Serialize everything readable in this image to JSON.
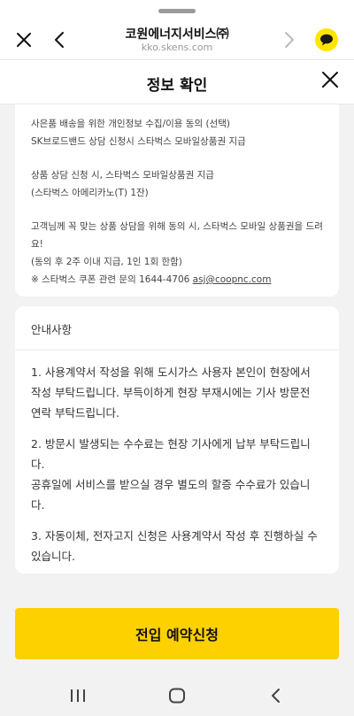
{
  "browser": {
    "title": "코원에너지서비스㈜",
    "url": "kko.skens.com"
  },
  "sheet": {
    "title": "정보 확인"
  },
  "consent": {
    "line1": "사은품 배송을 위한 개인정보 수집/이용 동의 (선택)",
    "line2": "SK브로드밴드 상담 신청시 스타벅스 모바일상품권 지급",
    "line3": "상품 상담 신청 시, 스타벅스 모바일상품권 지급",
    "line4": "(스타벅스 아메리카노(T) 1잔)",
    "line5": "고객님께 꼭 맞는 상품 상담을 위해 동의 시, 스타벅스 모바일 상품권을 드려요!",
    "line6": "(동의 후 2주 이내 지급, 1인 1회 한함)",
    "line7_prefix": "※ 스타벅스 쿠폰 관련 문의 1644-4706 ",
    "line7_email": "asj@coopnc.com"
  },
  "notice": {
    "heading": "안내사항",
    "p1a": "1. 사용계약서 작성을 위해 도시가스 사용자 본인이 현장에서",
    "p1b": "작성 부탁드립니다. 부득이하게 현장 부재시에는 기사 방문전",
    "p1c": "연락 부탁드립니다.",
    "p2a": "2. 방문시 발생되는 수수료는 현장 기사에게 납부 부탁드립니",
    "p2b": "다.",
    "p2c": "공휴일에 서비스를 받으실 경우 별도의 할증 수수료가 있습니",
    "p2d": "다.",
    "p3a": "3. 자동이체, 전자고지 신청은 사용계약서 작성 후 진행하실 수",
    "p3b": "있습니다."
  },
  "cta": {
    "label": "전입 예약신청"
  },
  "colors": {
    "accent": "#fdd000",
    "kakao": "#fee500"
  }
}
